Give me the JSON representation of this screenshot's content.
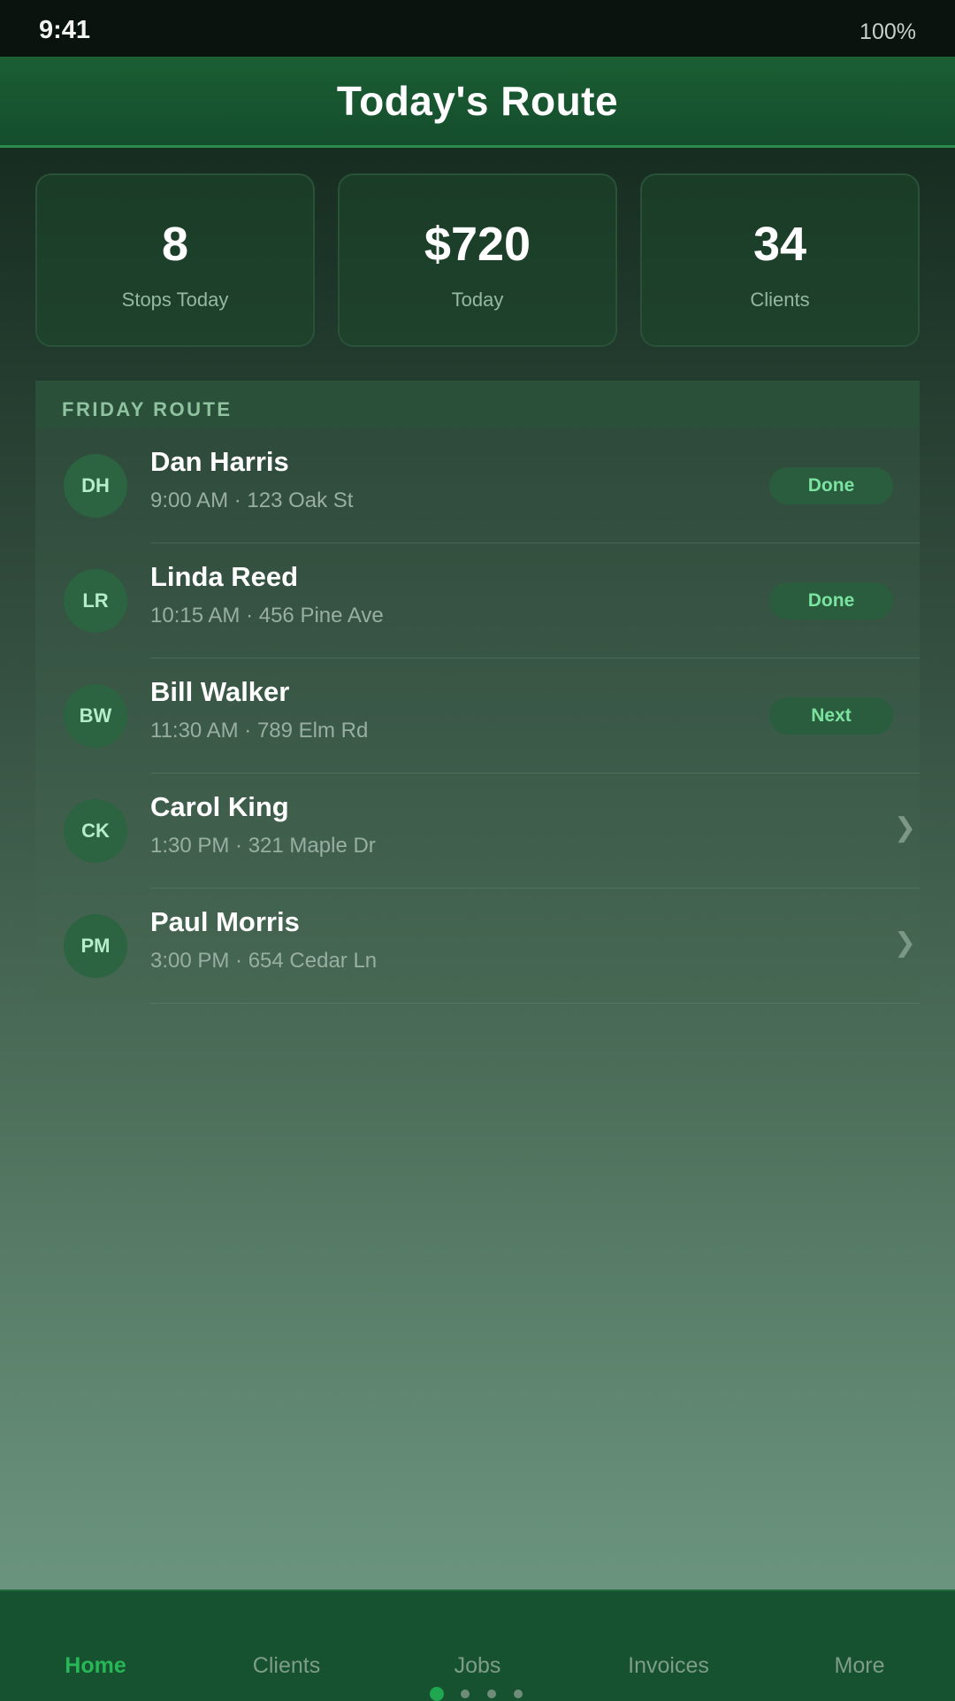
{
  "status_bar": {
    "time": "9:41",
    "battery": "100%"
  },
  "header": {
    "title": "Today's Route"
  },
  "stats": [
    {
      "value": "8",
      "label": "Stops Today"
    },
    {
      "value": "$720",
      "label": "Today"
    },
    {
      "value": "34",
      "label": "Clients"
    }
  ],
  "route": {
    "heading": "FRIDAY ROUTE",
    "stops": [
      {
        "initials": "DH",
        "name": "Dan Harris",
        "details": "9:00 AM · 123 Oak St",
        "status": "Done"
      },
      {
        "initials": "LR",
        "name": "Linda Reed",
        "details": "10:15 AM · 456 Pine Ave",
        "status": "Done"
      },
      {
        "initials": "BW",
        "name": "Bill Walker",
        "details": "11:30 AM · 789 Elm Rd",
        "status": "Next"
      },
      {
        "initials": "CK",
        "name": "Carol King",
        "details": "1:30 PM · 321 Maple Dr",
        "status": null
      },
      {
        "initials": "PM",
        "name": "Paul Morris",
        "details": "3:00 PM · 654 Cedar Ln",
        "status": null
      }
    ]
  },
  "tabs": [
    {
      "label": "Home",
      "active": true
    },
    {
      "label": "Clients",
      "active": false
    },
    {
      "label": "Jobs",
      "active": false
    },
    {
      "label": "Invoices",
      "active": false
    },
    {
      "label": "More",
      "active": false
    }
  ],
  "pager": {
    "count": 4,
    "active_index": 0
  },
  "colors": {
    "accent": "#27b757",
    "header": "#1b5e34",
    "badge_text": "#7be3a0"
  },
  "icons": {
    "chevron": "chevron-right-icon"
  }
}
